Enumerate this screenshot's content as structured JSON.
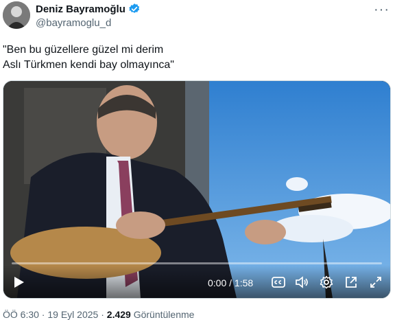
{
  "author": {
    "name": "Deniz Bayramoğlu",
    "handle": "@bayramoglu_d",
    "verified": true
  },
  "icons": {
    "verified": "verified-badge-icon",
    "more": "more-options-icon",
    "play": "play-icon",
    "captions": "captions-icon",
    "volume": "volume-icon",
    "settings": "gear-icon",
    "popout": "popout-icon",
    "fullscreen": "fullscreen-icon"
  },
  "more_label": "···",
  "tweet": {
    "lines": [
      "\"Ben bu güzellere güzel mi derim",
      "Aslı Türkmen kendi bay olmayınca\""
    ]
  },
  "video": {
    "time_current": "0:00",
    "time_total": "1:58",
    "time_separator": " / ",
    "progress": 0
  },
  "footer": {
    "time": "ÖÖ 6:30",
    "date": "19 Eyl 2025",
    "views_count": "2.429",
    "views_label": "Görüntülenme"
  },
  "colors": {
    "accent": "#1d9bf0",
    "text": "#0f1419",
    "secondary": "#536471"
  }
}
